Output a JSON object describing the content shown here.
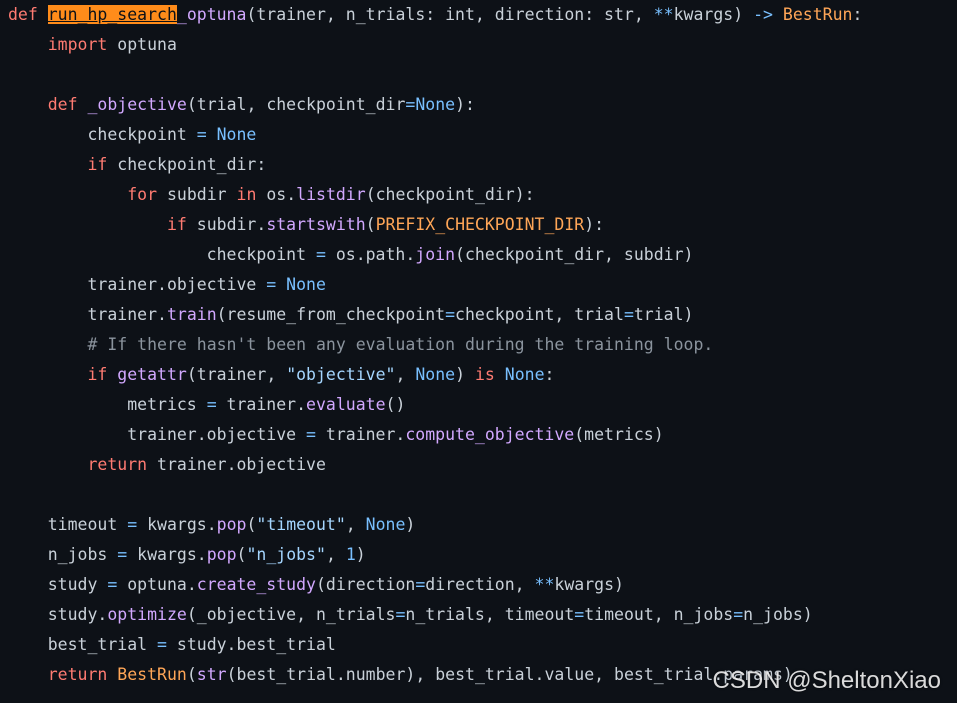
{
  "colors": {
    "background": "#0d1117",
    "text": "#c9d1d9",
    "keyword": "#ff7b72",
    "function": "#d2a8ff",
    "string": "#a5d6ff",
    "constant": "#79c0ff",
    "class": "#ffa657",
    "comment": "#8b949e",
    "highlight": "#ff8c1a"
  },
  "code_lines": [
    [
      [
        "kw",
        "def "
      ],
      [
        "hl",
        "run_hp_search"
      ],
      [
        "fn",
        "_optuna"
      ],
      [
        "plain",
        "(trainer, n_trials: int, direction: str, "
      ],
      [
        "op",
        "**"
      ],
      [
        "plain",
        "kwargs) "
      ],
      [
        "op",
        "->"
      ],
      [
        "plain",
        " "
      ],
      [
        "cls",
        "BestRun"
      ],
      [
        "plain",
        ":"
      ]
    ],
    [
      [
        "plain",
        "    "
      ],
      [
        "kw",
        "import"
      ],
      [
        "plain",
        " optuna"
      ]
    ],
    [],
    [
      [
        "plain",
        "    "
      ],
      [
        "kw",
        "def"
      ],
      [
        "plain",
        " "
      ],
      [
        "fn",
        "_objective"
      ],
      [
        "plain",
        "(trial, checkpoint_dir"
      ],
      [
        "op",
        "="
      ],
      [
        "const",
        "None"
      ],
      [
        "plain",
        "):"
      ]
    ],
    [
      [
        "plain",
        "        checkpoint "
      ],
      [
        "op",
        "="
      ],
      [
        "plain",
        " "
      ],
      [
        "const",
        "None"
      ]
    ],
    [
      [
        "plain",
        "        "
      ],
      [
        "kw",
        "if"
      ],
      [
        "plain",
        " checkpoint_dir:"
      ]
    ],
    [
      [
        "plain",
        "            "
      ],
      [
        "kw",
        "for"
      ],
      [
        "plain",
        " subdir "
      ],
      [
        "kw",
        "in"
      ],
      [
        "plain",
        " os."
      ],
      [
        "fn",
        "listdir"
      ],
      [
        "plain",
        "(checkpoint_dir):"
      ]
    ],
    [
      [
        "plain",
        "                "
      ],
      [
        "kw",
        "if"
      ],
      [
        "plain",
        " subdir."
      ],
      [
        "fn",
        "startswith"
      ],
      [
        "plain",
        "("
      ],
      [
        "cls",
        "PREFIX_CHECKPOINT_DIR"
      ],
      [
        "plain",
        "):"
      ]
    ],
    [
      [
        "plain",
        "                    checkpoint "
      ],
      [
        "op",
        "="
      ],
      [
        "plain",
        " os.path."
      ],
      [
        "fn",
        "join"
      ],
      [
        "plain",
        "(checkpoint_dir, subdir)"
      ]
    ],
    [
      [
        "plain",
        "        trainer.objective "
      ],
      [
        "op",
        "="
      ],
      [
        "plain",
        " "
      ],
      [
        "const",
        "None"
      ]
    ],
    [
      [
        "plain",
        "        trainer."
      ],
      [
        "fn",
        "train"
      ],
      [
        "plain",
        "(resume_from_checkpoint"
      ],
      [
        "op",
        "="
      ],
      [
        "plain",
        "checkpoint, trial"
      ],
      [
        "op",
        "="
      ],
      [
        "plain",
        "trial)"
      ]
    ],
    [
      [
        "plain",
        "        "
      ],
      [
        "cm",
        "# If there hasn't been any evaluation during the training loop."
      ]
    ],
    [
      [
        "plain",
        "        "
      ],
      [
        "kw",
        "if"
      ],
      [
        "plain",
        " "
      ],
      [
        "fn",
        "getattr"
      ],
      [
        "plain",
        "(trainer, "
      ],
      [
        "str",
        "\"objective\""
      ],
      [
        "plain",
        ", "
      ],
      [
        "const",
        "None"
      ],
      [
        "plain",
        ") "
      ],
      [
        "kw",
        "is"
      ],
      [
        "plain",
        " "
      ],
      [
        "const",
        "None"
      ],
      [
        "plain",
        ":"
      ]
    ],
    [
      [
        "plain",
        "            metrics "
      ],
      [
        "op",
        "="
      ],
      [
        "plain",
        " trainer."
      ],
      [
        "fn",
        "evaluate"
      ],
      [
        "plain",
        "()"
      ]
    ],
    [
      [
        "plain",
        "            trainer.objective "
      ],
      [
        "op",
        "="
      ],
      [
        "plain",
        " trainer."
      ],
      [
        "fn",
        "compute_objective"
      ],
      [
        "plain",
        "(metrics)"
      ]
    ],
    [
      [
        "plain",
        "        "
      ],
      [
        "kw",
        "return"
      ],
      [
        "plain",
        " trainer.objective"
      ]
    ],
    [],
    [
      [
        "plain",
        "    timeout "
      ],
      [
        "op",
        "="
      ],
      [
        "plain",
        " kwargs."
      ],
      [
        "fn",
        "pop"
      ],
      [
        "plain",
        "("
      ],
      [
        "str",
        "\"timeout\""
      ],
      [
        "plain",
        ", "
      ],
      [
        "const",
        "None"
      ],
      [
        "plain",
        ")"
      ]
    ],
    [
      [
        "plain",
        "    n_jobs "
      ],
      [
        "op",
        "="
      ],
      [
        "plain",
        " kwargs."
      ],
      [
        "fn",
        "pop"
      ],
      [
        "plain",
        "("
      ],
      [
        "str",
        "\"n_jobs\""
      ],
      [
        "plain",
        ", "
      ],
      [
        "const",
        "1"
      ],
      [
        "plain",
        ")"
      ]
    ],
    [
      [
        "plain",
        "    study "
      ],
      [
        "op",
        "="
      ],
      [
        "plain",
        " optuna."
      ],
      [
        "fn",
        "create_study"
      ],
      [
        "plain",
        "(direction"
      ],
      [
        "op",
        "="
      ],
      [
        "plain",
        "direction, "
      ],
      [
        "op",
        "**"
      ],
      [
        "plain",
        "kwargs)"
      ]
    ],
    [
      [
        "plain",
        "    study."
      ],
      [
        "fn",
        "optimize"
      ],
      [
        "plain",
        "(_objective, n_trials"
      ],
      [
        "op",
        "="
      ],
      [
        "plain",
        "n_trials, timeout"
      ],
      [
        "op",
        "="
      ],
      [
        "plain",
        "timeout, n_jobs"
      ],
      [
        "op",
        "="
      ],
      [
        "plain",
        "n_jobs)"
      ]
    ],
    [
      [
        "plain",
        "    best_trial "
      ],
      [
        "op",
        "="
      ],
      [
        "plain",
        " study.best_trial"
      ]
    ],
    [
      [
        "plain",
        "    "
      ],
      [
        "kw",
        "return"
      ],
      [
        "plain",
        " "
      ],
      [
        "cls",
        "BestRun"
      ],
      [
        "plain",
        "("
      ],
      [
        "fn",
        "str"
      ],
      [
        "plain",
        "(best_trial.number), best_trial.value, best_trial.params)"
      ]
    ]
  ],
  "watermark": "CSDN @SheltonXiao"
}
